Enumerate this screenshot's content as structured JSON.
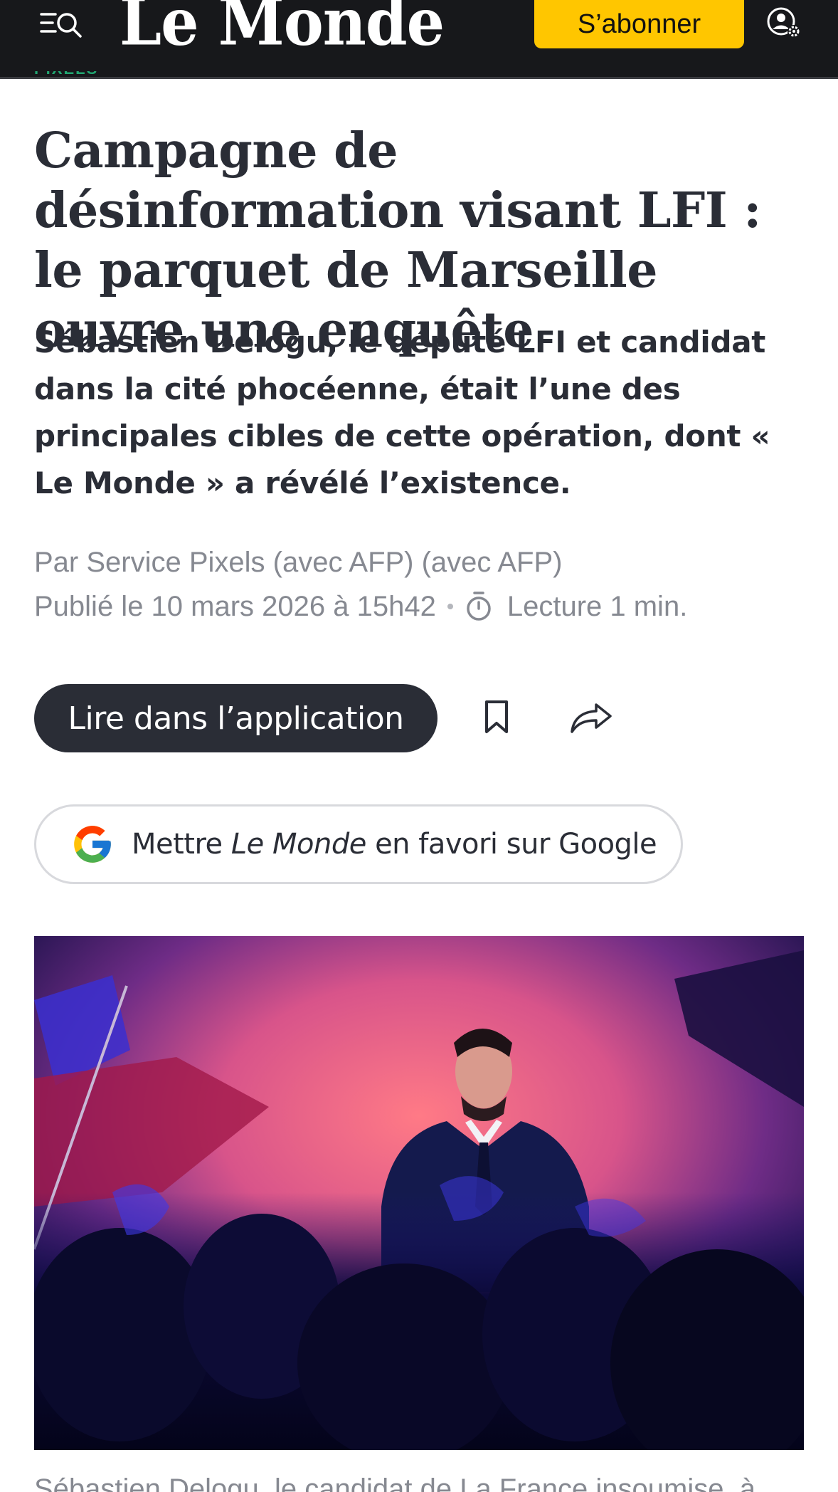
{
  "header": {
    "logo_text": "Le Monde",
    "subscribe_label": "S’abonner",
    "menu_icon": "menu-search-icon",
    "account_icon": "account-settings-icon",
    "background_color": "#17181b",
    "subscribe_color": "#ffc600"
  },
  "article": {
    "rubric": "PIXELS",
    "title": "Campagne de désinformation visant LFI : le parquet de Marseille ouvre une enquête",
    "subtitle": "Sébastien Delogu, le député LFI et candidat dans la cité phocéenne, était l’une des principales cibles de cette opération, dont « Le Monde » a révélé l’existence.",
    "byline": "Par Service Pixels (avec AFP) (avec AFP)",
    "published": "Publié le 10 mars 2026 à 15h42",
    "reading_time": "Lecture 1 min.",
    "caption": "Sébastien Delogu, le candidat de La France insoumise, à"
  },
  "actions": {
    "app_button_label": "Lire dans l’application",
    "bookmark_icon": "bookmark-icon",
    "share_icon": "share-icon",
    "google_prefix": "Mettre",
    "google_brand": "Le Monde",
    "google_suffix": "en favori sur Google"
  },
  "colors": {
    "accent_green": "#21a672",
    "text_dark": "#2a2d36",
    "text_muted": "#868991"
  }
}
